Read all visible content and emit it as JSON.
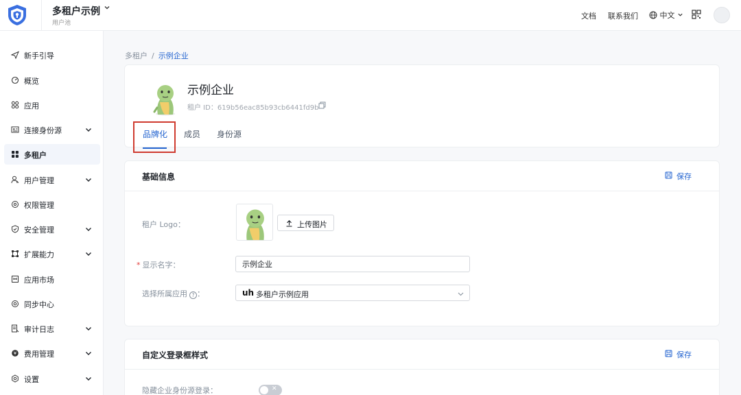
{
  "topbar": {
    "app_name": "多租户示例",
    "app_sub": "用户池",
    "links": {
      "docs": "文档",
      "contact": "联系我们"
    },
    "language": "中文"
  },
  "sidebar": {
    "items": [
      {
        "label": "新手引导",
        "icon": "send-icon",
        "expandable": false,
        "active": false
      },
      {
        "label": "概览",
        "icon": "dashboard-icon",
        "expandable": false,
        "active": false
      },
      {
        "label": "应用",
        "icon": "apps-icon",
        "expandable": false,
        "active": false
      },
      {
        "label": "连接身份源",
        "icon": "id-card-icon",
        "expandable": true,
        "active": false
      },
      {
        "label": "多租户",
        "icon": "grid-icon",
        "expandable": false,
        "active": true
      },
      {
        "label": "用户管理",
        "icon": "user-icon",
        "expandable": true,
        "active": false
      },
      {
        "label": "权限管理",
        "icon": "permission-icon",
        "expandable": false,
        "active": false
      },
      {
        "label": "安全管理",
        "icon": "shield-icon",
        "expandable": true,
        "active": false
      },
      {
        "label": "扩展能力",
        "icon": "extension-icon",
        "expandable": true,
        "active": false
      },
      {
        "label": "应用市场",
        "icon": "market-icon",
        "expandable": false,
        "active": false
      },
      {
        "label": "同步中心",
        "icon": "sync-icon",
        "expandable": false,
        "active": false
      },
      {
        "label": "审计日志",
        "icon": "log-icon",
        "expandable": true,
        "active": false
      },
      {
        "label": "费用管理",
        "icon": "billing-icon",
        "expandable": true,
        "active": false
      },
      {
        "label": "设置",
        "icon": "settings-icon",
        "expandable": true,
        "active": false
      }
    ]
  },
  "breadcrumb": {
    "parent": "多租户",
    "separator": "/",
    "current": "示例企业"
  },
  "tenant": {
    "name": "示例企业",
    "id_label": "租户 ID：",
    "id_value": "619b56eac85b93cb6441fd9b"
  },
  "tabs": [
    {
      "label": "品牌化",
      "active": true
    },
    {
      "label": "成员",
      "active": false
    },
    {
      "label": "身份源",
      "active": false
    }
  ],
  "basic_info": {
    "title": "基础信息",
    "save_label": "保存",
    "logo_label": "租户 Logo：",
    "upload_label": "上传图片",
    "display_name_label": "显示名字：",
    "display_name_value": "示例企业",
    "app_select_label": "选择所属应用",
    "app_select_suffix": "：",
    "app_select_value": "多租户示例应用",
    "app_select_logo": "uh"
  },
  "login_style": {
    "title": "自定义登录框样式",
    "save_label": "保存",
    "hide_idp_label": "隐藏企业身份源登录：",
    "hide_idp_enabled": false
  },
  "colors": {
    "accent": "#2565d0",
    "highlight": "#cf3a2e",
    "required": "#e23c39"
  }
}
